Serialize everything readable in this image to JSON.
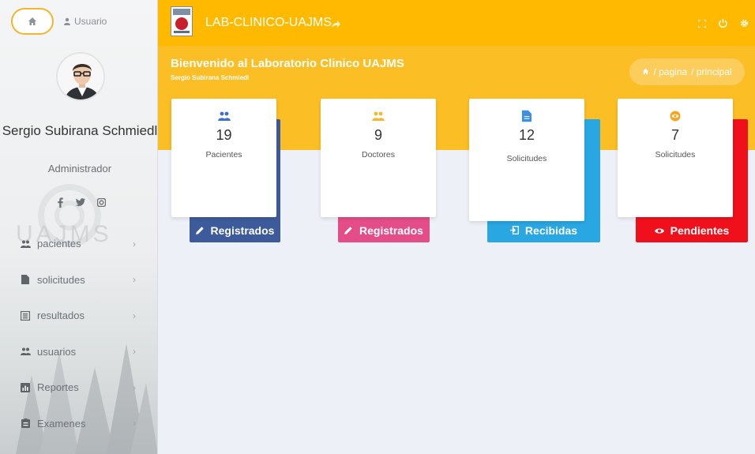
{
  "sidebar": {
    "user_link": "Usuario",
    "user_name": "Sergio Subirana Schmiedl",
    "user_role": "Administrador",
    "watermark_text": "UAJMS",
    "socials": [
      "facebook-icon",
      "twitter-icon",
      "instagram-icon"
    ],
    "items": [
      {
        "label": "pacientes",
        "icon": "users-icon"
      },
      {
        "label": "solicitudes",
        "icon": "file-icon"
      },
      {
        "label": "resultados",
        "icon": "list-icon"
      },
      {
        "label": "usuarios",
        "icon": "users-icon"
      },
      {
        "label": "Reportes",
        "icon": "chart-icon"
      },
      {
        "label": "Examenes",
        "icon": "clipboard-icon"
      }
    ]
  },
  "topbar": {
    "title": "LAB-CLINICO-UAJMS"
  },
  "header": {
    "welcome": "Bienvenido al Laboratorio Clinico UAJMS",
    "subtitle": "Sergio Subirana Schmiedl",
    "breadcrumb": [
      "/ pagina",
      "/ principal"
    ]
  },
  "cards": [
    {
      "value": "19",
      "label": "Pacientes",
      "footer": "Registrados",
      "color": "#3d5b9b",
      "icon": "users-icon"
    },
    {
      "value": "9",
      "label": "Doctores",
      "footer": "Registrados",
      "color": "#e44d87",
      "icon": "users-icon"
    },
    {
      "value": "12",
      "label": "Solicitudes",
      "footer": "Recibidas",
      "color": "#29a7e3",
      "icon": "file-icon"
    },
    {
      "value": "7",
      "label": "Solicitudes",
      "footer": "Pendientes",
      "color": "#f0101c",
      "icon": "eye-icon"
    }
  ],
  "colors": {
    "accent": "#ffba00",
    "band": "#fbbe25",
    "card_icon_blue": "#3d6fd1",
    "card_icon_yellow": "#f3b82b",
    "card_icon_blue2": "#3b8fe4",
    "card_icon_orange": "#f5a623"
  }
}
